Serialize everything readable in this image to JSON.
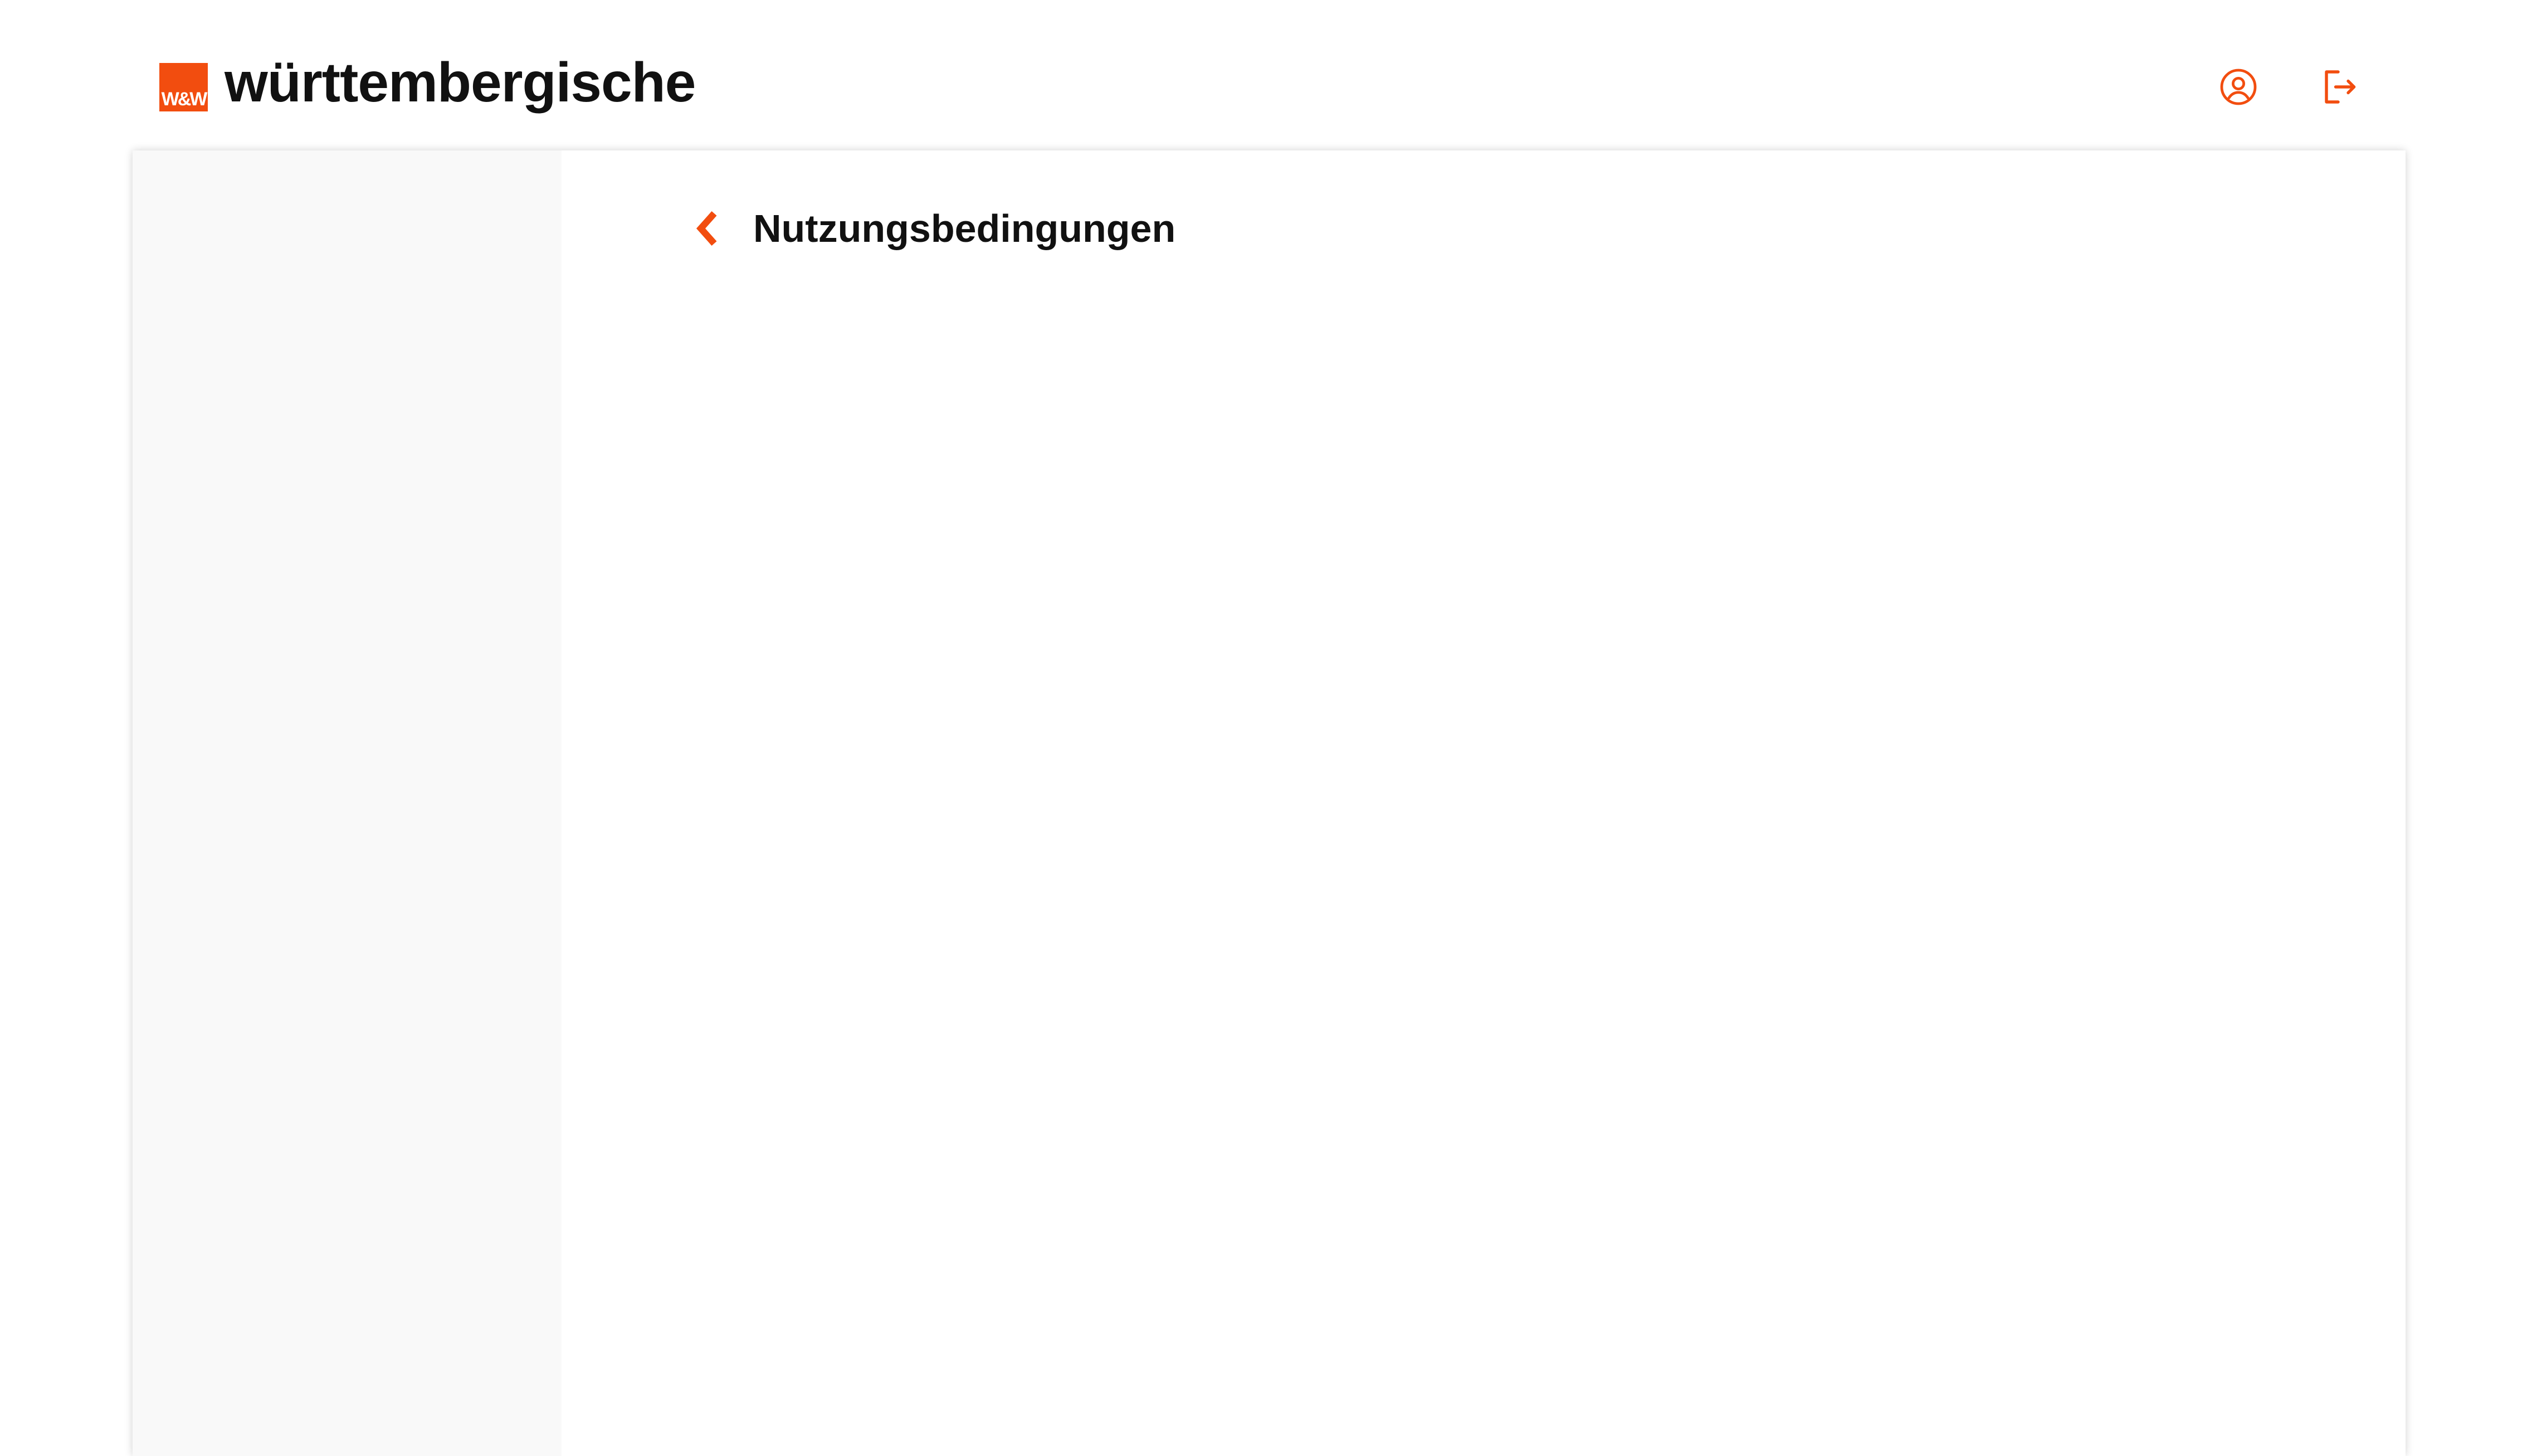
{
  "brand": {
    "mark_text": "W&W",
    "name": "württembergische",
    "accent_color": "#f24d0f"
  },
  "header": {
    "icons": [
      "user-circle-icon",
      "logout-icon"
    ]
  },
  "page": {
    "title": "Nutzungsbedingungen",
    "back_icon": "chevron-left-icon"
  }
}
